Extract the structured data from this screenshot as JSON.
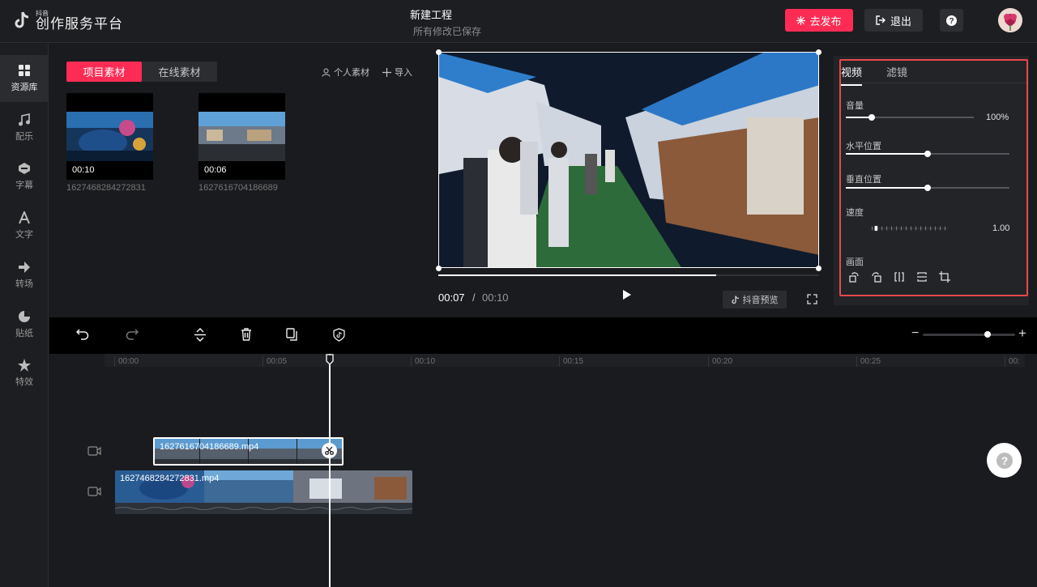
{
  "header": {
    "logo_small": "抖音",
    "logo_title": "创作服务平台",
    "project_title": "新建工程",
    "save_status": "所有修改已保存",
    "publish_label": "去发布",
    "exit_label": "退出"
  },
  "sidebar": {
    "items": [
      {
        "label": "资源库",
        "icon": "library-icon"
      },
      {
        "label": "配乐",
        "icon": "music-icon"
      },
      {
        "label": "字幕",
        "icon": "subtitle-icon"
      },
      {
        "label": "文字",
        "icon": "text-icon"
      },
      {
        "label": "转场",
        "icon": "transition-icon"
      },
      {
        "label": "贴纸",
        "icon": "sticker-icon"
      },
      {
        "label": "特效",
        "icon": "effects-icon"
      }
    ]
  },
  "media": {
    "tabs": [
      "项目素材",
      "在线素材"
    ],
    "personal_label": "个人素材",
    "import_label": "导入",
    "items": [
      {
        "duration": "00:10",
        "name": "1627468284272831"
      },
      {
        "duration": "00:06",
        "name": "1627616704186689"
      }
    ]
  },
  "preview": {
    "current_time": "00:07",
    "separator": "/",
    "total_time": "00:10",
    "progress": 0.73,
    "douyin_preview_label": "抖音预览"
  },
  "inspector": {
    "tabs": [
      "视频",
      "滤镜"
    ],
    "volume_label": "音量",
    "volume_value": "100%",
    "volume_level": 0.2,
    "hpos_label": "水平位置",
    "hpos_level": 0.5,
    "vpos_label": "垂直位置",
    "vpos_level": 0.5,
    "speed_label": "速度",
    "speed_value": "1.00",
    "frame_label": "画面"
  },
  "timeline": {
    "ruler": [
      "00:00",
      "00:05",
      "00:10",
      "00:15",
      "00:20",
      "00:25",
      "00:"
    ],
    "clip_top": "1627616704186689.mp4",
    "clip_bottom": "1627468284272831.mp4"
  },
  "colors": {
    "accent": "#fe2c55",
    "highlight_border": "#e8484a"
  }
}
